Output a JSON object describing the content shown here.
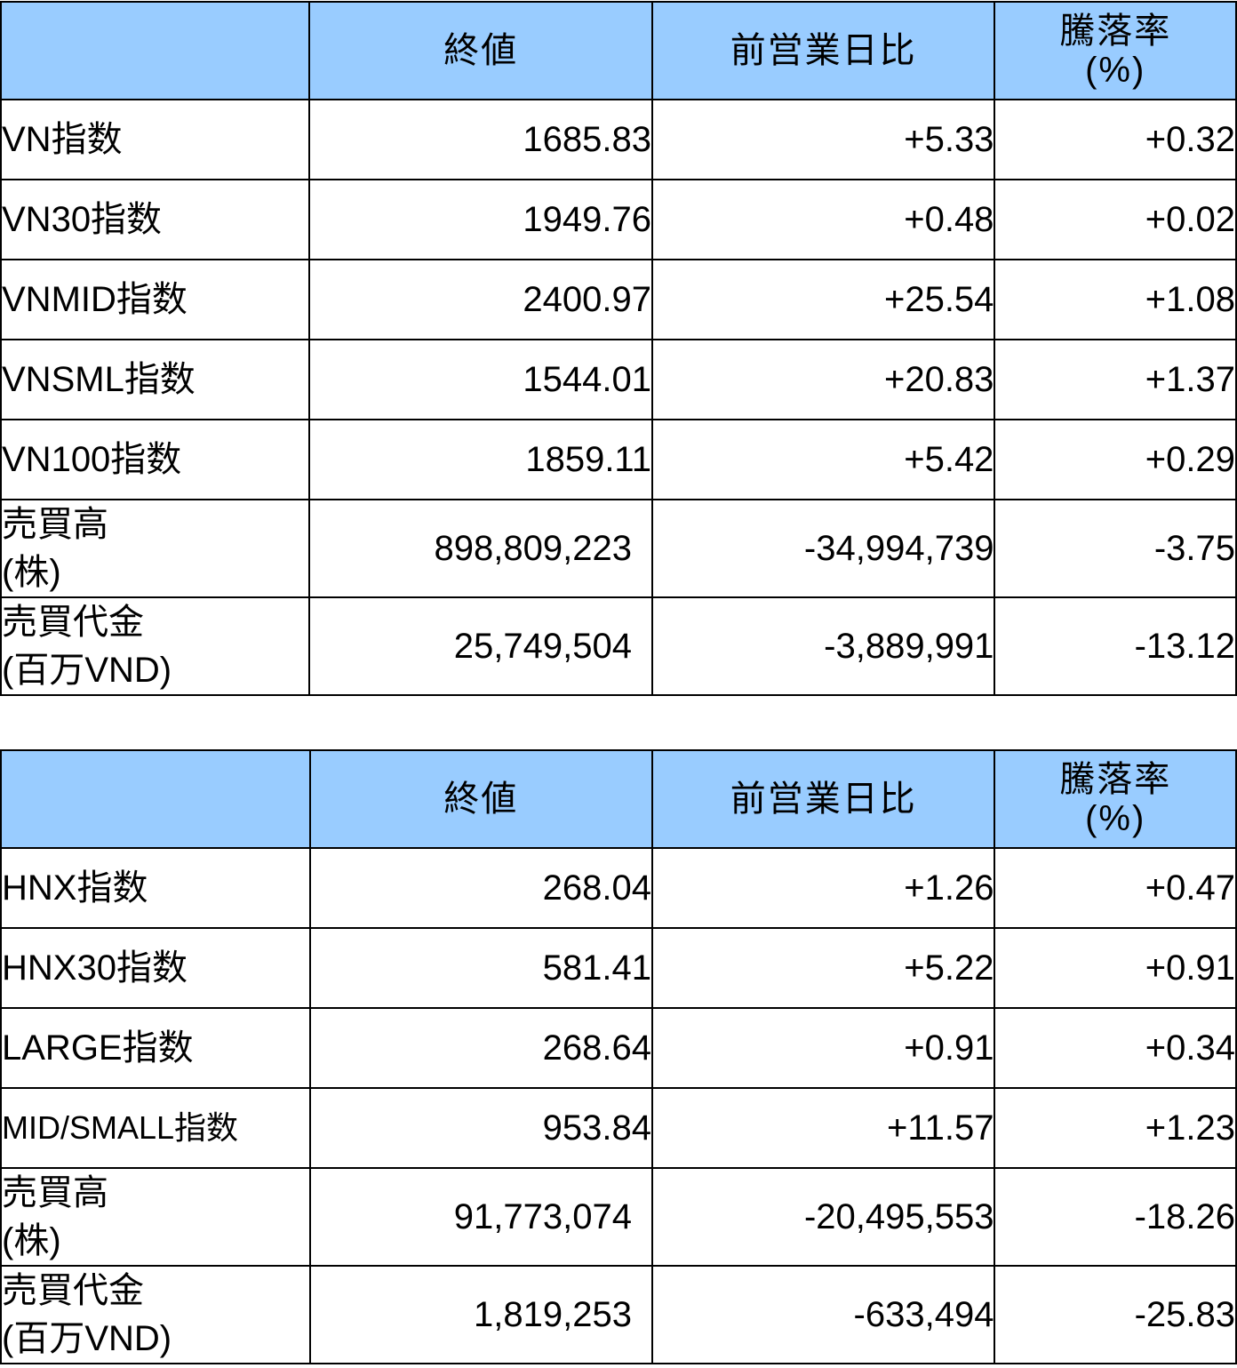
{
  "tables": [
    {
      "headers": [
        "",
        "終値",
        "前営業日比",
        "騰落率",
        "(%)"
      ],
      "rows": [
        {
          "label": "VN指数",
          "label2": "",
          "close": "1685.83",
          "change": "+5.33",
          "pct": "+0.32"
        },
        {
          "label": "VN30指数",
          "label2": "",
          "close": "1949.76",
          "change": "+0.48",
          "pct": "+0.02"
        },
        {
          "label": "VNMID指数",
          "label2": "",
          "close": "2400.97",
          "change": "+25.54",
          "pct": "+1.08"
        },
        {
          "label": "VNSML指数",
          "label2": "",
          "close": "1544.01",
          "change": "+20.83",
          "pct": "+1.37"
        },
        {
          "label": "VN100指数",
          "label2": "",
          "close": "1859.11",
          "change": "+5.42",
          "pct": "+0.29"
        },
        {
          "label": "売買高",
          "label2": "(株)",
          "close": "898,809,223",
          "change": "-34,994,739",
          "pct": "-3.75"
        },
        {
          "label": "売買代金",
          "label2": "(百万VND)",
          "close": "25,749,504",
          "change": "-3,889,991",
          "pct": "-13.12"
        }
      ]
    },
    {
      "headers": [
        "",
        "終値",
        "前営業日比",
        "騰落率",
        "(%)"
      ],
      "rows": [
        {
          "label": "HNX指数",
          "label2": "",
          "close": "268.04",
          "change": "+1.26",
          "pct": "+0.47"
        },
        {
          "label": "HNX30指数",
          "label2": "",
          "close": "581.41",
          "change": "+5.22",
          "pct": "+0.91"
        },
        {
          "label": "LARGE指数",
          "label2": "",
          "close": "268.64",
          "change": "+0.91",
          "pct": "+0.34"
        },
        {
          "label": "MID/SMALL指数",
          "label2": "",
          "close": "953.84",
          "change": "+11.57",
          "pct": "+1.23"
        },
        {
          "label": "売買高",
          "label2": "(株)",
          "close": "91,773,074",
          "change": "-20,495,553",
          "pct": "-18.26"
        },
        {
          "label": "売買代金",
          "label2": "(百万VND)",
          "close": "1,819,253",
          "change": "-633,494",
          "pct": "-25.83"
        }
      ]
    }
  ],
  "colors": {
    "header_bg": "#99ccff",
    "border": "#000000",
    "text": "#000000"
  }
}
